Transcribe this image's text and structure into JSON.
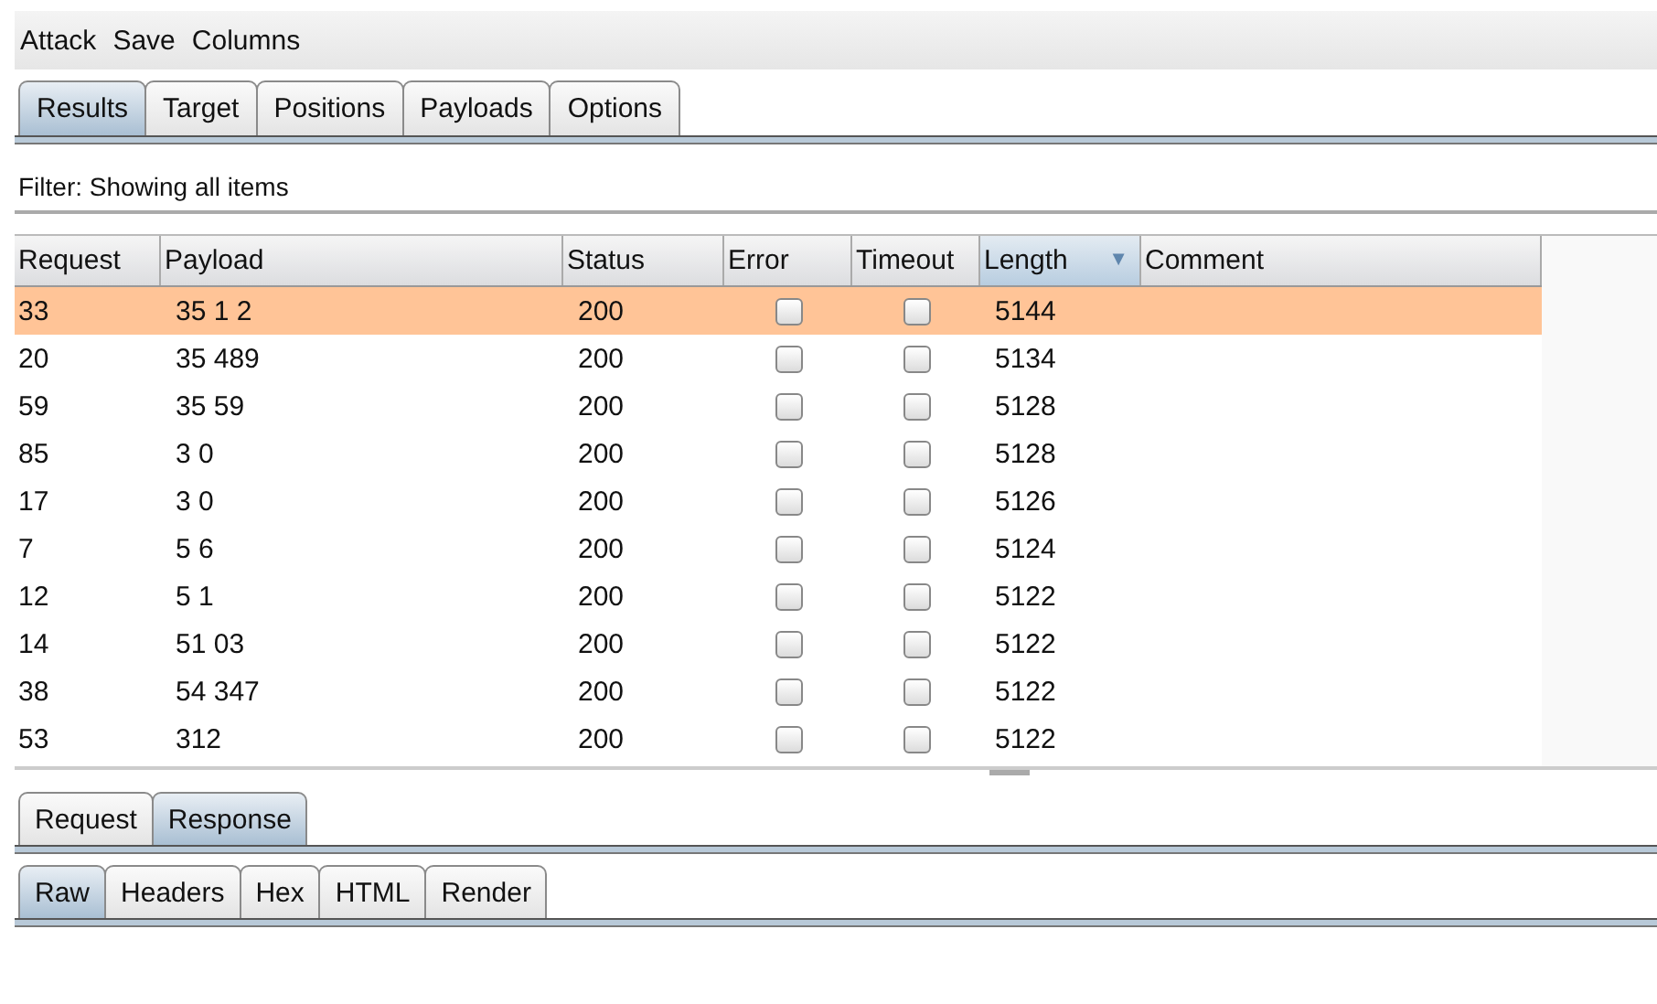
{
  "menu": [
    "Attack",
    "Save",
    "Columns"
  ],
  "tabs": [
    {
      "label": "Results",
      "selected": true
    },
    {
      "label": "Target",
      "selected": false
    },
    {
      "label": "Positions",
      "selected": false
    },
    {
      "label": "Payloads",
      "selected": false
    },
    {
      "label": "Options",
      "selected": false
    }
  ],
  "filter": "Filter: Showing all items",
  "table": {
    "columns": [
      {
        "label": "Request",
        "sorted": false
      },
      {
        "label": "Payload",
        "sorted": false
      },
      {
        "label": "Status",
        "sorted": false
      },
      {
        "label": "Error",
        "sorted": false
      },
      {
        "label": "Timeout",
        "sorted": false
      },
      {
        "label": "Length",
        "sorted": true
      },
      {
        "label": "Comment",
        "sorted": false
      }
    ],
    "sort_arrow": "▼",
    "rows": [
      {
        "request": "33",
        "payload": "35 1 2",
        "status": "200",
        "error": false,
        "timeout": false,
        "length": "5144",
        "selected": true
      },
      {
        "request": "20",
        "payload": "35 489",
        "status": "200",
        "error": false,
        "timeout": false,
        "length": "5134",
        "selected": false
      },
      {
        "request": "59",
        "payload": "35 59",
        "status": "200",
        "error": false,
        "timeout": false,
        "length": "5128",
        "selected": false
      },
      {
        "request": "85",
        "payload": "3 0",
        "status": "200",
        "error": false,
        "timeout": false,
        "length": "5128",
        "selected": false
      },
      {
        "request": "17",
        "payload": "3 0",
        "status": "200",
        "error": false,
        "timeout": false,
        "length": "5126",
        "selected": false
      },
      {
        "request": "7",
        "payload": "5 6",
        "status": "200",
        "error": false,
        "timeout": false,
        "length": "5124",
        "selected": false
      },
      {
        "request": "12",
        "payload": "5 1",
        "status": "200",
        "error": false,
        "timeout": false,
        "length": "5122",
        "selected": false
      },
      {
        "request": "14",
        "payload": "51 03",
        "status": "200",
        "error": false,
        "timeout": false,
        "length": "5122",
        "selected": false
      },
      {
        "request": "38",
        "payload": "54 347",
        "status": "200",
        "error": false,
        "timeout": false,
        "length": "5122",
        "selected": false
      },
      {
        "request": "53",
        "payload": "312",
        "status": "200",
        "error": false,
        "timeout": false,
        "length": "5122",
        "selected": false
      }
    ]
  },
  "message_tabs": [
    {
      "label": "Request",
      "selected": false
    },
    {
      "label": "Response",
      "selected": true
    }
  ],
  "view_tabs": [
    {
      "label": "Raw",
      "selected": true
    },
    {
      "label": "Headers",
      "selected": false
    },
    {
      "label": "Hex",
      "selected": false
    },
    {
      "label": "HTML",
      "selected": false
    },
    {
      "label": "Render",
      "selected": false
    }
  ]
}
